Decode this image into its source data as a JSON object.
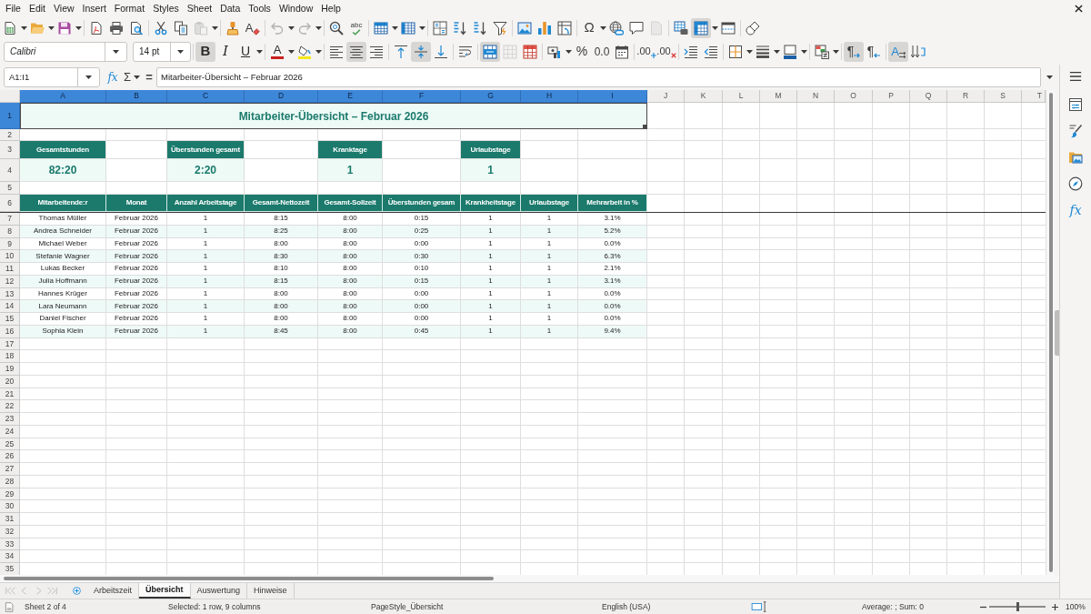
{
  "menu_bar": [
    "File",
    "Edit",
    "View",
    "Insert",
    "Format",
    "Styles",
    "Sheet",
    "Data",
    "Tools",
    "Window",
    "Help"
  ],
  "standard_toolbar": {
    "clear_formatting_glyph": "A",
    "spelling_glyph": "abc",
    "special_character_glyph": "Ω",
    "paste_disabled": true,
    "undo_disabled": true,
    "redo_disabled": true,
    "headers_footers_disabled": true,
    "freeze_rows_columns": true
  },
  "formatting_toolbar": {
    "font_name": "Calibri",
    "font_size": "14 pt",
    "bold": {
      "glyph": "B",
      "on": true
    },
    "italic": {
      "glyph": "I",
      "on": false
    },
    "underline": {
      "glyph": "U",
      "on": false
    },
    "font_color_glyph": "A",
    "align_left": false,
    "align_center": true,
    "align_right": false,
    "align_top": false,
    "align_middle": true,
    "align_bottom": false,
    "wrap_text": false,
    "merge_and_center": true,
    "merge_cells_disabled": true,
    "percent_glyph": "%",
    "number_glyph": "0.0",
    "add_decimal_glyph": ".00",
    "delete_decimal_glyph": ".00",
    "left_to_right": {
      "glyph": "¶",
      "on": true
    },
    "right_to_left": {
      "glyph": "¶",
      "on": false
    },
    "text_horizontal": {
      "glyph": "A",
      "on": true
    },
    "text_vertical": false
  },
  "formula_bar": {
    "name_box": "A1:I1",
    "function_wizard_glyph": "fx",
    "sum_glyph": "Σ",
    "equals_glyph": "=",
    "content": "Mitarbeiter-Übersicht – Februar 2026"
  },
  "sheet": {
    "columns": [
      {
        "label": "A",
        "selected": true
      },
      {
        "label": "B",
        "selected": true
      },
      {
        "label": "C",
        "selected": true
      },
      {
        "label": "D",
        "selected": true
      },
      {
        "label": "E",
        "selected": true
      },
      {
        "label": "F",
        "selected": true
      },
      {
        "label": "G",
        "selected": true
      },
      {
        "label": "H",
        "selected": true
      },
      {
        "label": "I",
        "selected": true
      },
      {
        "label": "J",
        "selected": false
      },
      {
        "label": "K",
        "selected": false
      },
      {
        "label": "L",
        "selected": false
      },
      {
        "label": "M",
        "selected": false
      },
      {
        "label": "N",
        "selected": false
      },
      {
        "label": "O",
        "selected": false
      },
      {
        "label": "P",
        "selected": false
      },
      {
        "label": "Q",
        "selected": false
      },
      {
        "label": "R",
        "selected": false
      },
      {
        "label": "S",
        "selected": false
      },
      {
        "label": "T",
        "selected": false
      }
    ],
    "rows": [
      {
        "label": "1",
        "selected": true
      },
      {
        "label": "2",
        "selected": false
      },
      {
        "label": "3",
        "selected": false
      },
      {
        "label": "4",
        "selected": false
      },
      {
        "label": "5",
        "selected": false
      },
      {
        "label": "6",
        "selected": false
      },
      {
        "label": "7",
        "selected": false
      },
      {
        "label": "8",
        "selected": false
      },
      {
        "label": "9",
        "selected": false
      },
      {
        "label": "10",
        "selected": false
      },
      {
        "label": "11",
        "selected": false
      },
      {
        "label": "12",
        "selected": false
      },
      {
        "label": "13",
        "selected": false
      },
      {
        "label": "14",
        "selected": false
      },
      {
        "label": "15",
        "selected": false
      },
      {
        "label": "16",
        "selected": false
      },
      {
        "label": "17",
        "selected": false
      },
      {
        "label": "18",
        "selected": false
      },
      {
        "label": "19",
        "selected": false
      },
      {
        "label": "20",
        "selected": false
      },
      {
        "label": "21",
        "selected": false
      },
      {
        "label": "22",
        "selected": false
      },
      {
        "label": "23",
        "selected": false
      },
      {
        "label": "24",
        "selected": false
      },
      {
        "label": "25",
        "selected": false
      },
      {
        "label": "26",
        "selected": false
      },
      {
        "label": "27",
        "selected": false
      },
      {
        "label": "28",
        "selected": false
      },
      {
        "label": "29",
        "selected": false
      },
      {
        "label": "30",
        "selected": false
      },
      {
        "label": "31",
        "selected": false
      },
      {
        "label": "32",
        "selected": false
      },
      {
        "label": "33",
        "selected": false
      },
      {
        "label": "34",
        "selected": false
      },
      {
        "label": "35",
        "selected": false
      }
    ],
    "title": {
      "text": "Mitarbeiter-Übersicht – Februar 2026",
      "selected": true
    },
    "summary": [
      {
        "label": "Gesamtstunden",
        "value": "82:20"
      },
      {
        "label": "Überstunden gesamt",
        "value": "2:20"
      },
      {
        "label": "Kranktage",
        "value": "1"
      },
      {
        "label": "Urlaubstage",
        "value": "1"
      }
    ],
    "table": {
      "columns": [
        "Mitarbeitende:r",
        "Monat",
        "Anzahl Arbeitstage",
        "Gesamt-Nettozeit",
        "Gesamt-Sollzeit",
        "Überstunden gesam",
        "Krankheitstage",
        "Urlaubstage",
        "Mehrarbeit in %"
      ],
      "rows": [
        [
          "Thomas Müller",
          "Februar 2026",
          "1",
          "8:15",
          "8:00",
          "0:15",
          "1",
          "1",
          "3.1%"
        ],
        [
          "Andrea Schneider",
          "Februar 2026",
          "1",
          "8:25",
          "8:00",
          "0:25",
          "1",
          "1",
          "5.2%"
        ],
        [
          "Michael Weber",
          "Februar 2026",
          "1",
          "8:00",
          "8:00",
          "0:00",
          "1",
          "1",
          "0.0%"
        ],
        [
          "Stefanie Wagner",
          "Februar 2026",
          "1",
          "8:30",
          "8:00",
          "0:30",
          "1",
          "1",
          "6.3%"
        ],
        [
          "Lukas Becker",
          "Februar 2026",
          "1",
          "8:10",
          "8:00",
          "0:10",
          "1",
          "1",
          "2.1%"
        ],
        [
          "Julia Hoffmann",
          "Februar 2026",
          "1",
          "8:15",
          "8:00",
          "0:15",
          "1",
          "1",
          "3.1%"
        ],
        [
          "Hannes Krüger",
          "Februar 2026",
          "1",
          "8:00",
          "8:00",
          "0:00",
          "1",
          "1",
          "0.0%"
        ],
        [
          "Lara Neumann",
          "Februar 2026",
          "1",
          "8:00",
          "8:00",
          "0:00",
          "1",
          "1",
          "0.0%"
        ],
        [
          "Daniel Fischer",
          "Februar 2026",
          "1",
          "8:00",
          "8:00",
          "0:00",
          "1",
          "1",
          "0.0%"
        ],
        [
          "Sophia Klein",
          "Februar 2026",
          "1",
          "8:45",
          "8:00",
          "0:45",
          "1",
          "1",
          "9.4%"
        ]
      ]
    }
  },
  "sheet_tabs": [
    {
      "label": "Arbeitszeit",
      "selected": false
    },
    {
      "label": "Übersicht",
      "selected": true
    },
    {
      "label": "Auswertung",
      "selected": false
    },
    {
      "label": "Hinweise",
      "selected": false
    }
  ],
  "sidebar": {
    "functions_glyph": "fx"
  },
  "status_bar": {
    "sheet": "Sheet 2 of 4",
    "selection": "Selected: 1 row, 9 columns",
    "page_style": "PageStyle_Übersicht",
    "language": "English (USA)",
    "sum": "Average: ; Sum: 0",
    "zoom": {
      "level": 0.5,
      "reading": "100%"
    }
  }
}
